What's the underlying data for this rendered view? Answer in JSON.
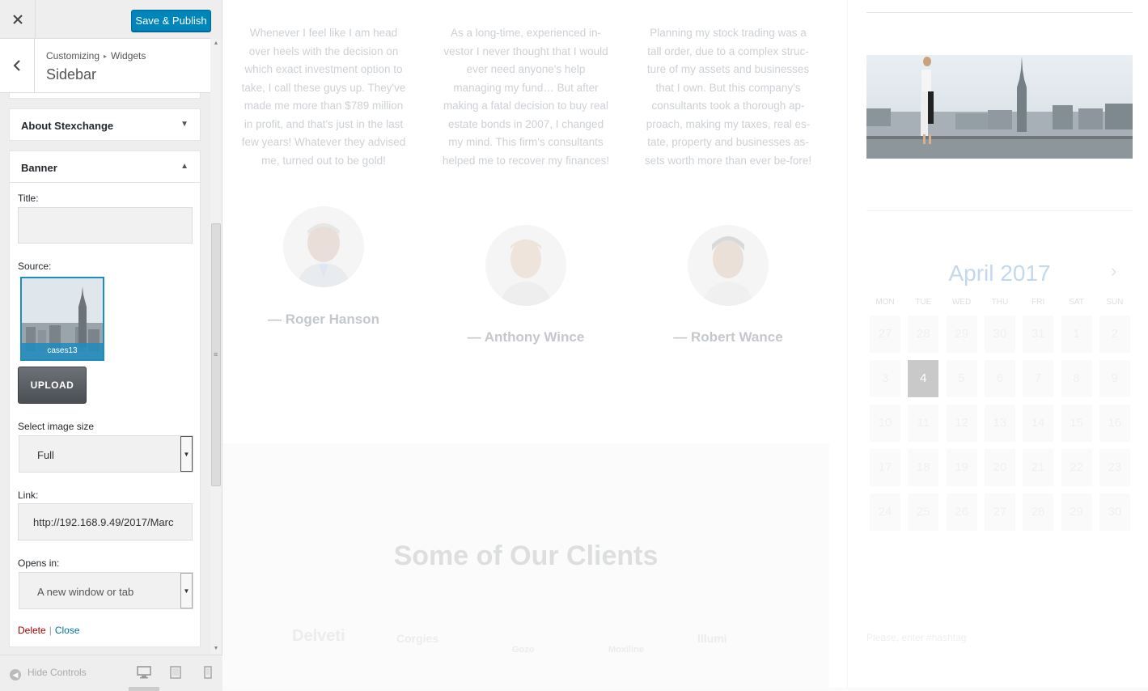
{
  "header": {
    "close_icon": "close-icon",
    "publish_label": "Save & Publish"
  },
  "section": {
    "crumb_root": "Customizing",
    "crumb_child": "Widgets",
    "title": "Sidebar"
  },
  "widgets": {
    "about_label": "About Stexchange",
    "banner_label": "Banner"
  },
  "banner_form": {
    "title_label": "Title:",
    "title_value": "",
    "source_label": "Source:",
    "source_file": "cases13",
    "upload_label": "UPLOAD",
    "size_label": "Select image size",
    "size_value": "Full",
    "link_label": "Link:",
    "link_value": "http://192.168.9.49/2017/Marc",
    "opens_label": "Opens in:",
    "opens_value": "A new window or tab",
    "delete_label": "Delete",
    "close_label": "Close"
  },
  "footer": {
    "hide_controls": "Hide Controls"
  },
  "preview": {
    "quotes": [
      "Whenever I feel like I am head over heels with the decision on which exact investment option to take, I call these guys up. They've made me more than $789 million in profit, and that's just in the last few years! Whatever they advised me, turned out to be gold!",
      "As a long-time, experienced in-vestor I never thought that I would ever need anyone's help managing my fund… But after making a fatal decision to buy real estate bonds in 2007, I changed my mind. This firm's consultants helped me to recover my finances!",
      "Planning my stock trading was a tall order, due to a complex struc-ture of my assets and businesses that I own. But this company's consultants took a thorough ap-proach, making my taxes, real es-tate, property and businesses as-sets worth more than ever be-fore!"
    ],
    "authors": [
      "— Roger Hanson",
      "— Anthony Wince",
      "— Robert Wance"
    ],
    "clients_title": "Some of Our Clients",
    "client_logos": [
      "Delveti",
      "Corgies",
      "Gozo",
      "Moxiline",
      "Illumi"
    ],
    "calendar": {
      "title": "April 2017",
      "day_heads": [
        "MON",
        "TUE",
        "WED",
        "THU",
        "FRI",
        "SAT",
        "SUN"
      ],
      "weeks": [
        [
          "27",
          "28",
          "29",
          "30",
          "31",
          "1",
          "2"
        ],
        [
          "3",
          "4",
          "5",
          "6",
          "7",
          "8",
          "9"
        ],
        [
          "10",
          "11",
          "12",
          "13",
          "14",
          "15",
          "16"
        ],
        [
          "17",
          "18",
          "19",
          "20",
          "21",
          "22",
          "23"
        ],
        [
          "24",
          "25",
          "26",
          "27",
          "28",
          "29",
          "30"
        ]
      ],
      "active_day": "4"
    },
    "hashtag_placeholder": "Please, enter #hashtag"
  }
}
